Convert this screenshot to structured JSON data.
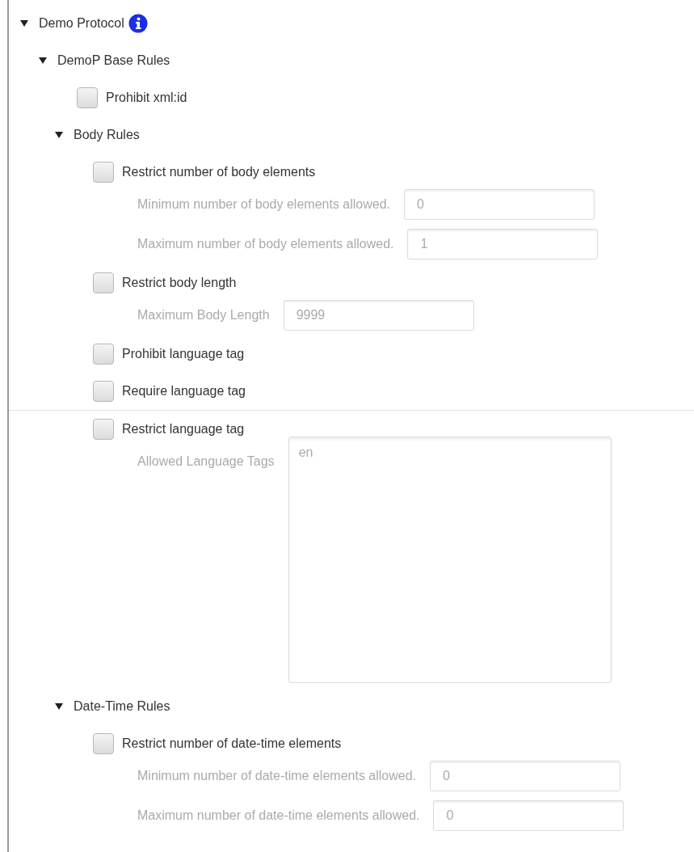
{
  "tree": {
    "kind": "group",
    "label": "Demo Protocol",
    "expanded": true,
    "children": [
      {
        "kind": "group",
        "label": "DemoP Base Rules",
        "expanded": true,
        "children": [
          {
            "kind": "checkbox",
            "label": "Prohibit xml:id",
            "checked": false
          },
          {
            "kind": "group",
            "label": "Body Rules",
            "expanded": true,
            "children": [
              {
                "kind": "checkbox",
                "label": "Restrict number of body elements",
                "checked": false,
                "fields": [
                  {
                    "kind": "text",
                    "label": "Minimum number of body elements allowed.",
                    "value": "0",
                    "disabled": true
                  },
                  {
                    "kind": "text",
                    "label": "Maximum number of body elements allowed.",
                    "value": "1",
                    "disabled": true
                  }
                ]
              },
              {
                "kind": "checkbox",
                "label": "Restrict body length",
                "checked": false,
                "fields": [
                  {
                    "kind": "text",
                    "label": "Maximum Body Length",
                    "value": "9999",
                    "disabled": true
                  }
                ]
              },
              {
                "kind": "checkbox",
                "label": "Prohibit language tag",
                "checked": false
              },
              {
                "kind": "checkbox",
                "label": "Require language tag",
                "checked": false
              },
              {
                "kind": "divider"
              },
              {
                "kind": "checkbox",
                "label": "Restrict language tag",
                "checked": false,
                "fields": [
                  {
                    "kind": "textarea",
                    "label": "Allowed Language Tags",
                    "value": "en",
                    "disabled": true
                  }
                ]
              }
            ]
          },
          {
            "kind": "group",
            "label": "Date-Time Rules",
            "expanded": true,
            "children": [
              {
                "kind": "checkbox",
                "label": "Restrict number of date-time elements",
                "checked": false,
                "fields": [
                  {
                    "kind": "text",
                    "label": "Minimum number of date-time elements allowed.",
                    "value": "0",
                    "disabled": true
                  },
                  {
                    "kind": "text",
                    "label": "Maximum number of date-time elements allowed.",
                    "value": "0",
                    "disabled": true
                  }
                ]
              }
            ]
          }
        ]
      }
    ]
  }
}
